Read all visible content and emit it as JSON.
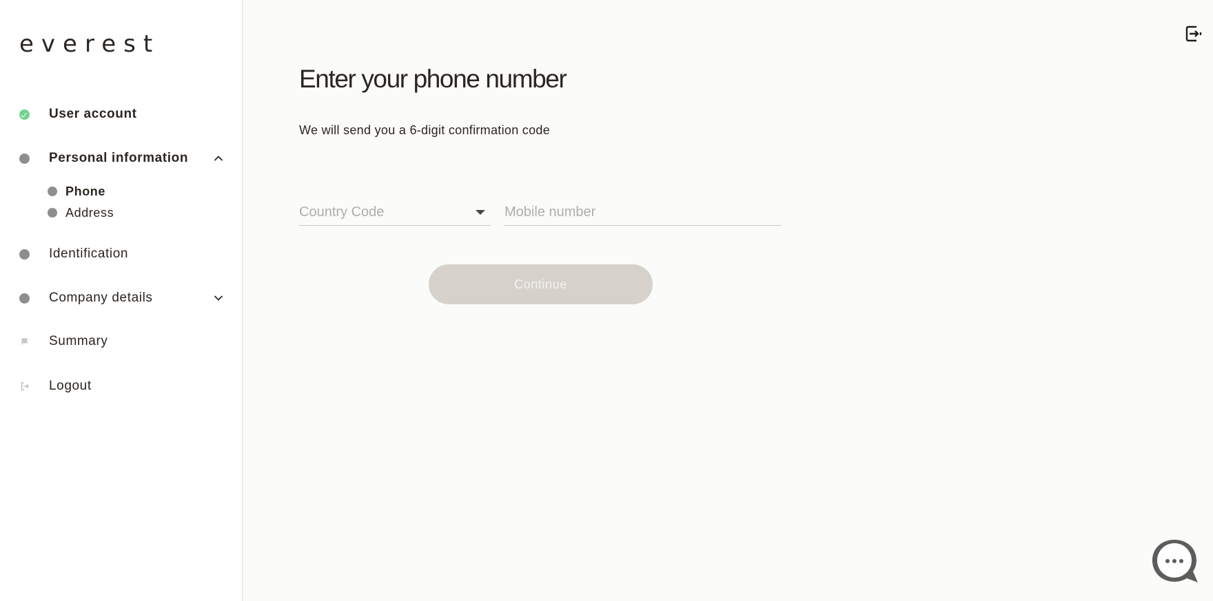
{
  "brand": {
    "logo_text": "everest"
  },
  "sidebar": {
    "items": [
      {
        "label": "User account",
        "status": "done"
      },
      {
        "label": "Personal information",
        "status": "active",
        "expanded": true,
        "children": [
          {
            "label": "Phone",
            "active": true
          },
          {
            "label": "Address",
            "active": false
          }
        ]
      },
      {
        "label": "Identification",
        "status": "pending"
      },
      {
        "label": "Company details",
        "status": "pending",
        "expanded": false
      },
      {
        "label": "Summary",
        "icon": "flag-icon"
      },
      {
        "label": "Logout",
        "icon": "logout-icon"
      }
    ]
  },
  "main": {
    "title": "Enter your phone number",
    "subtitle": "We will send you a 6-digit confirmation code",
    "country_code": {
      "placeholder": "Country Code"
    },
    "mobile": {
      "placeholder": "Mobile number",
      "value": ""
    },
    "continue_label": "Continue"
  },
  "colors": {
    "accent_done": "#6fd38e",
    "button_disabled": "#d6d2cb",
    "text": "#2b2520",
    "background": "#fbfbfa"
  },
  "icons": {
    "top_right": "exit-icon",
    "bottom_right": "chat-icon"
  }
}
